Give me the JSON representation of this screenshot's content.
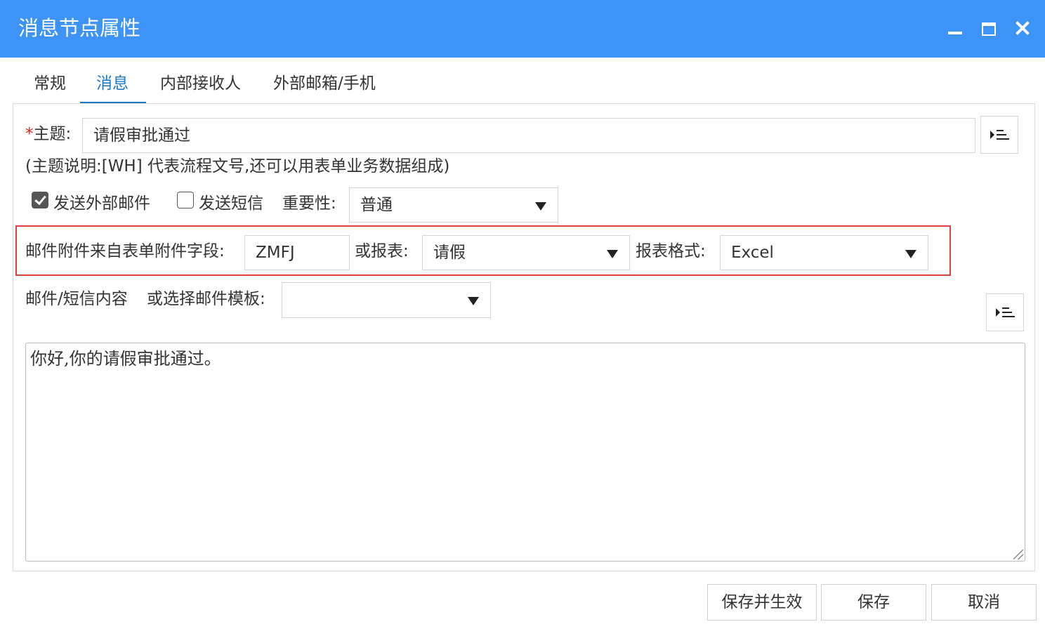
{
  "window": {
    "title": "消息节点属性",
    "controls": [
      "minimize-icon",
      "maximize-icon",
      "close-icon"
    ],
    "accent_color": "#3d94f6"
  },
  "tabs": [
    {
      "label": "常规",
      "active": false
    },
    {
      "label": "消息",
      "active": true
    },
    {
      "label": "内部接收人",
      "active": false
    },
    {
      "label": "外部邮箱/手机",
      "active": false
    }
  ],
  "subject": {
    "required_mark": "*",
    "label": "主题:",
    "value": "请假审批通过",
    "hint": "(主题说明:[WH] 代表流程文号,还可以用表单业务数据组成)"
  },
  "options": {
    "send_email_label": "发送外部邮件",
    "send_email_checked": true,
    "send_sms_label": "发送短信",
    "send_sms_checked": false,
    "importance_label": "重要性:",
    "importance_value": "普通"
  },
  "attachment": {
    "field_label": "邮件附件来自表单附件字段:",
    "field_value": "ZMFJ",
    "report_label": "或报表:",
    "report_value": "请假",
    "format_label": "报表格式:",
    "format_value": "Excel",
    "highlight_color": "#e04040"
  },
  "content": {
    "label": "邮件/短信内容",
    "template_label": "或选择邮件模板:",
    "template_value": "",
    "body": "你好,你的请假审批通过。"
  },
  "buttons": {
    "save_apply": "保存并生效",
    "save": "保存",
    "cancel": "取消"
  }
}
